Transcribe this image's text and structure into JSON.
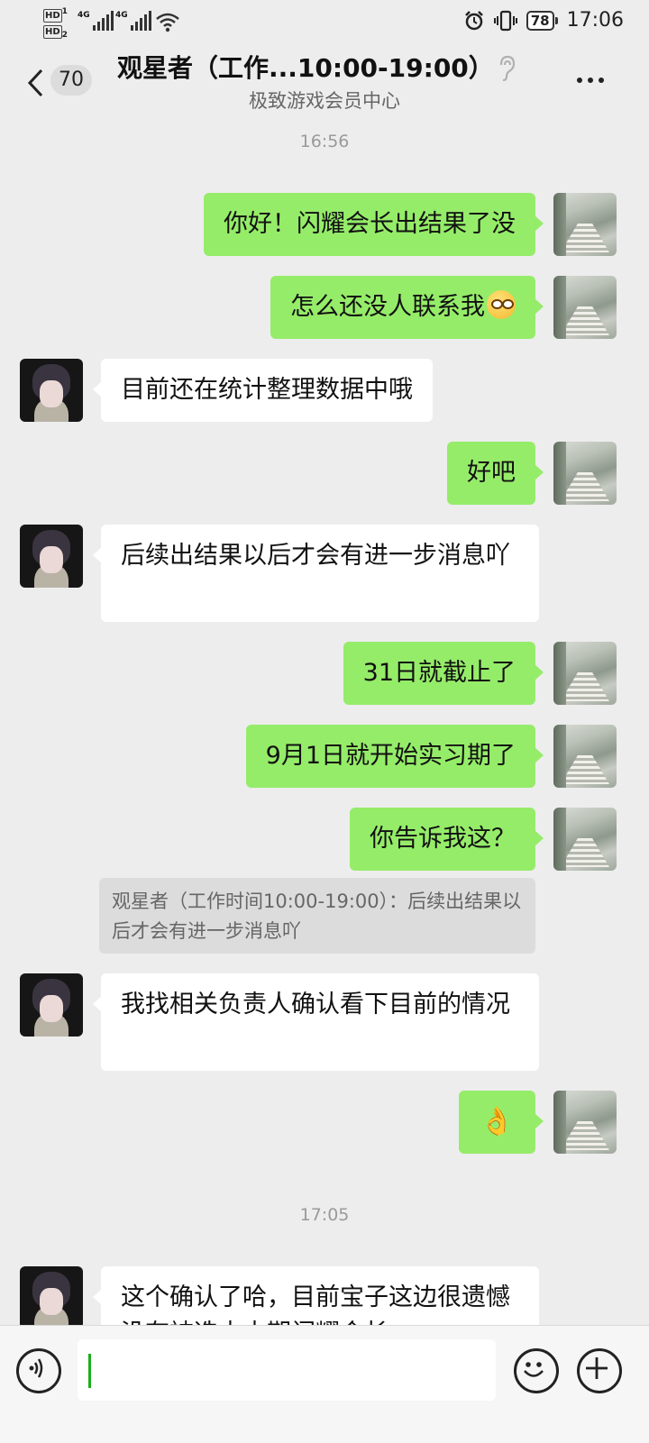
{
  "status_bar": {
    "hd1": "HD",
    "hd1_sub": "1",
    "hd2": "HD",
    "hd2_sub": "2",
    "net1": "4G",
    "net2": "4G",
    "battery": "78",
    "time": "17:06"
  },
  "header": {
    "unread_count": "70",
    "title": "观星者（工作...10:00-19:00）",
    "subtitle": "极致游戏会员中心"
  },
  "timestamps": [
    "16:56",
    "17:05"
  ],
  "messages": [
    {
      "from": "me",
      "text": "你好！闪耀会长出结果了没"
    },
    {
      "from": "me",
      "text": "怎么还没人联系我",
      "emoji": "grinning-face-with-glasses"
    },
    {
      "from": "them",
      "text": "目前还在统计整理数据中哦"
    },
    {
      "from": "me",
      "text": "好吧"
    },
    {
      "from": "them",
      "text": "后续出结果以后才会有进一步消息吖"
    },
    {
      "from": "me",
      "text": "31日就截止了"
    },
    {
      "from": "me",
      "text": "9月1日就开始实习期了"
    },
    {
      "from": "me",
      "text": "你告诉我这？"
    },
    {
      "from": "them",
      "text": "我找相关负责人确认看下目前的情况"
    },
    {
      "from": "me",
      "text": "👌"
    },
    {
      "from": "them",
      "text": "这个确认了哈，目前宝子这边很遗憾没有被选中本期闪耀会长"
    }
  ],
  "quote": {
    "text": "观星者（工作时间10:00-19:00）：后续出结果以后才会有进一步消息吖"
  },
  "input": {
    "value": ""
  },
  "colors": {
    "my_bubble": "#95ec69",
    "their_bubble": "#ffffff",
    "background": "#ededed",
    "caret": "#1aad19"
  }
}
